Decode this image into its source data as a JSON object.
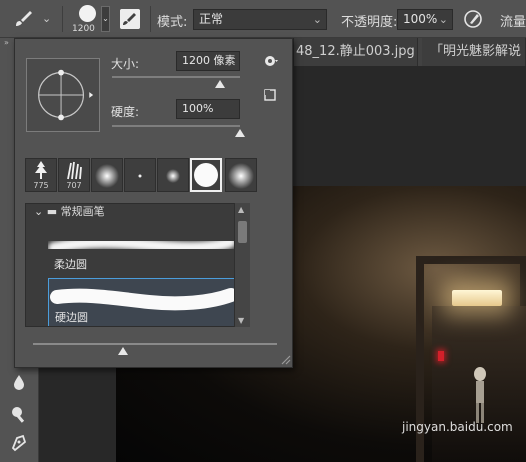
{
  "options_bar": {
    "brush_size": "1200",
    "mode_label": "模式:",
    "mode_value": "正常",
    "opacity_label": "不透明度:",
    "opacity_value": "100%",
    "flow_label": "流量"
  },
  "tabs": [
    {
      "title": "48_12.静止003.jpg",
      "close": "×"
    },
    {
      "title": "「明光魅影解说"
    }
  ],
  "brush_popup": {
    "size_label": "大小:",
    "size_value": "1200 像素",
    "size_fraction": 0.84,
    "hardness_label": "硬度:",
    "hardness_value": "100%",
    "hardness_fraction": 1.0,
    "recent_brushes": [
      {
        "icon": "tree-brush-icon",
        "number": "775"
      },
      {
        "icon": "grass-brush-icon",
        "number": "707"
      },
      {
        "icon": "soft-round-brush-icon",
        "number": ""
      },
      {
        "icon": "small-hard-brush-icon",
        "number": ""
      },
      {
        "icon": "soft-round-small-brush-icon",
        "number": ""
      },
      {
        "icon": "hard-round-brush-icon",
        "number": "",
        "selected": true
      },
      {
        "icon": "soft-round-large-brush-icon",
        "number": ""
      }
    ],
    "group_name": "常规画笔",
    "presets": [
      {
        "name": "柔边圆",
        "type": "soft"
      },
      {
        "name": "硬边圆",
        "type": "hard",
        "active": true
      }
    ],
    "preview_size_fraction": 0.37
  },
  "watermark": "jingyan.baidu.com",
  "colors": {
    "panel_bg": "#535353",
    "field_bg": "#3c3c3c",
    "accent_selection": "#4b9ddb",
    "canvas_bg": "#282828"
  }
}
